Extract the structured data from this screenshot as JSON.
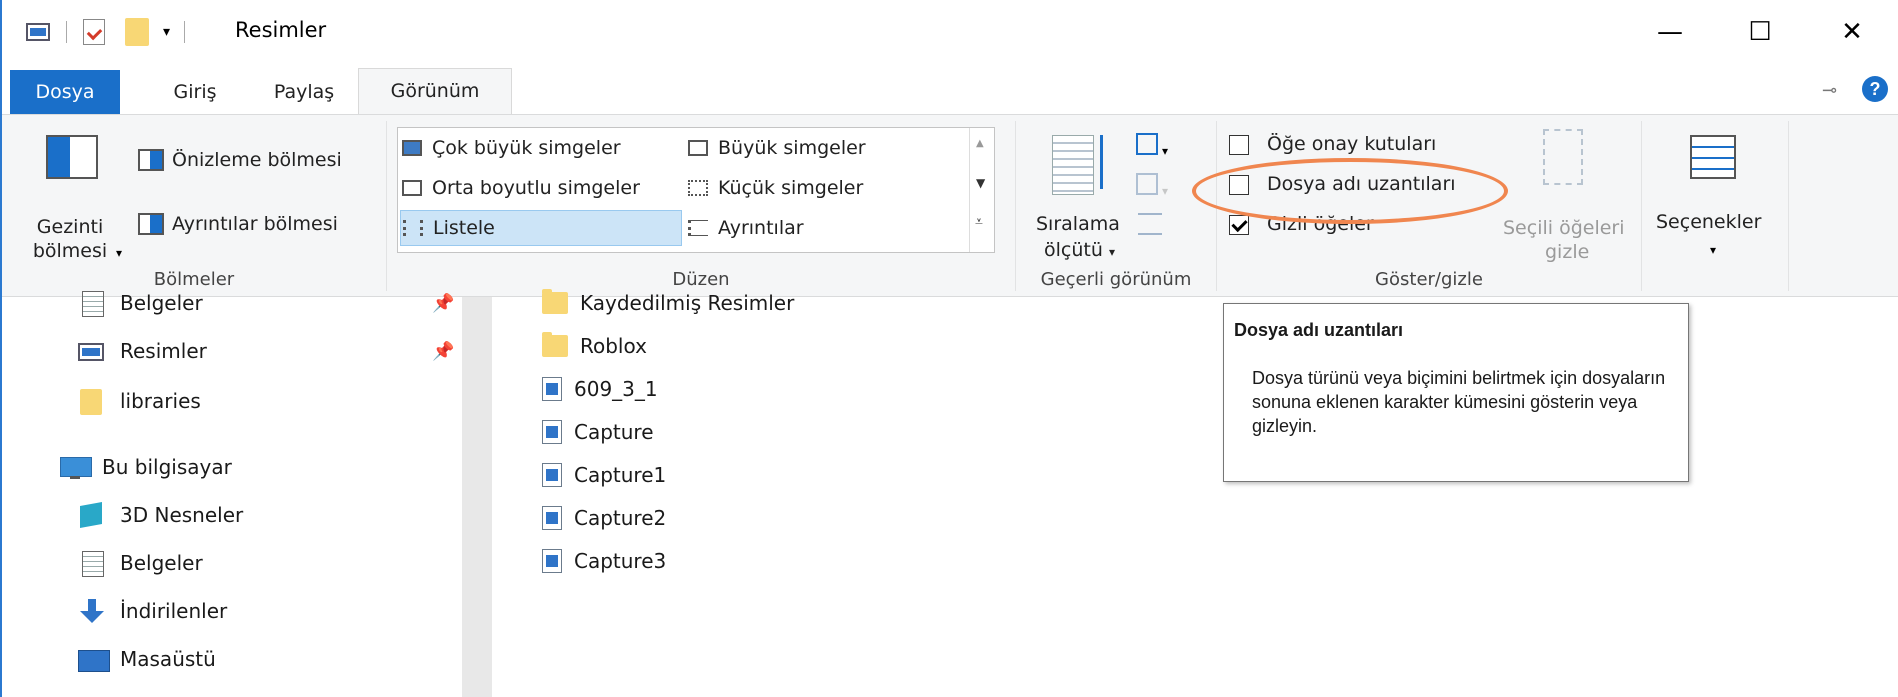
{
  "window": {
    "title": "Resimler",
    "controls": {
      "minimize": "—",
      "maximize": "☐",
      "close": "✕"
    }
  },
  "tabs": [
    {
      "label": "Dosya"
    },
    {
      "label": "Giriş"
    },
    {
      "label": "Paylaş"
    },
    {
      "label": "Görünüm"
    }
  ],
  "ribbon": {
    "panes": {
      "nav_pane_label": "Gezinti bölmesi",
      "preview_pane": "Önizleme bölmesi",
      "details_pane": "Ayrıntılar bölmesi",
      "group_label": "Bölmeler"
    },
    "layout": {
      "items": [
        "Çok büyük simgeler",
        "Büyük simgeler",
        "Orta boyutlu simgeler",
        "Küçük simgeler",
        "Listele",
        "Ayrıntılar"
      ],
      "group_label": "Düzen"
    },
    "current_view": {
      "sort_by_line1": "Sıralama",
      "sort_by_line2": "ölçütü",
      "group_label": "Geçerli görünüm"
    },
    "show_hide": {
      "item_checkboxes": "Öğe onay kutuları",
      "file_name_extensions": "Dosya adı uzantıları",
      "hidden_items": "Gizli öğeler",
      "hide_selected_line1": "Seçili öğeleri",
      "hide_selected_line2": "gizle",
      "group_label": "Göster/gizle",
      "item_checkboxes_checked": false,
      "file_name_extensions_checked": false,
      "hidden_items_checked": true
    },
    "options": {
      "label": "Seçenekler"
    }
  },
  "nav": {
    "items": [
      {
        "label": "Belgeler"
      },
      {
        "label": "Resimler"
      },
      {
        "label": "libraries"
      },
      {
        "label": "Bu bilgisayar"
      },
      {
        "label": "3D Nesneler"
      },
      {
        "label": "Belgeler"
      },
      {
        "label": "İndirilenler"
      },
      {
        "label": "Masaüstü"
      }
    ]
  },
  "files": [
    {
      "name": "Kaydedilmiş Resimler",
      "type": "folder"
    },
    {
      "name": "Roblox",
      "type": "folder"
    },
    {
      "name": "609_3_1",
      "type": "image"
    },
    {
      "name": "Capture",
      "type": "image"
    },
    {
      "name": "Capture1",
      "type": "image"
    },
    {
      "name": "Capture2",
      "type": "image"
    },
    {
      "name": "Capture3",
      "type": "image"
    }
  ],
  "tooltip": {
    "title": "Dosya adı uzantıları",
    "body": "Dosya türünü veya biçimini belirtmek için dosyaların sonuna eklenen karakter kümesini gösterin veya gizleyin."
  },
  "colors": {
    "accent": "#1a6fc9",
    "highlight_ellipse": "#f0864f",
    "selection": "#cce4f7"
  }
}
